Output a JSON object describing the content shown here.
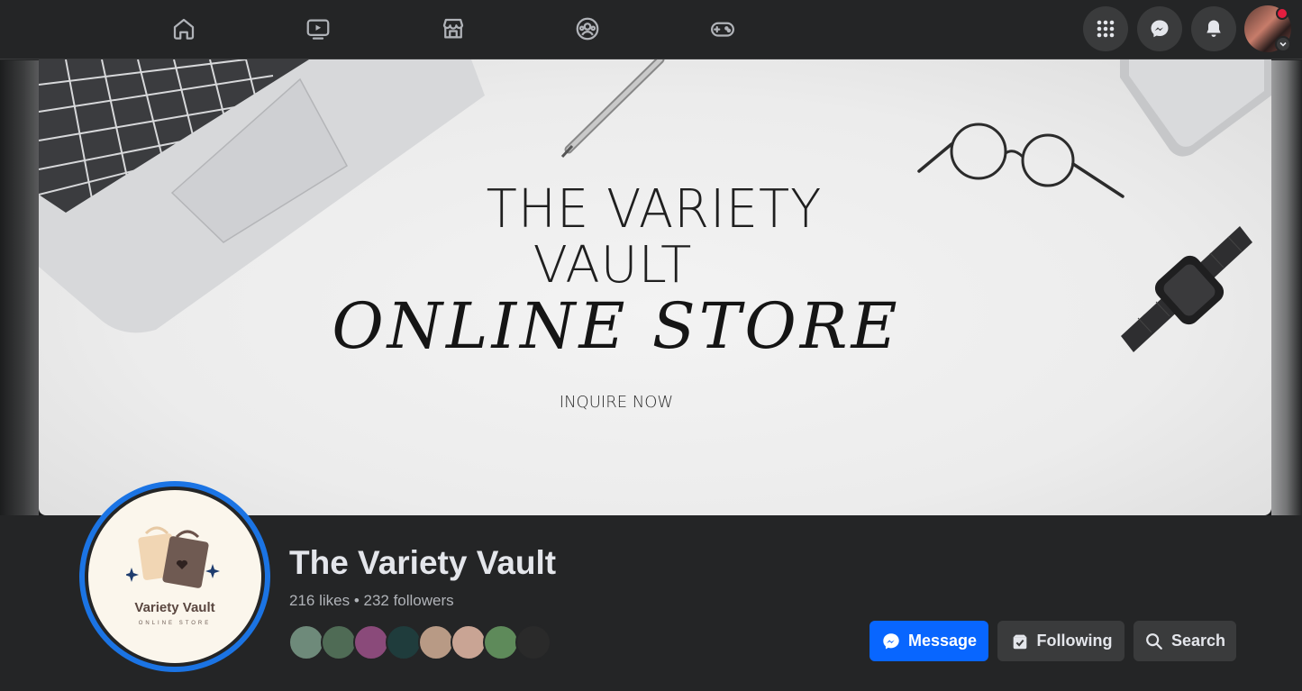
{
  "nav": {
    "tabs": [
      {
        "name": "home",
        "icon": "home-icon"
      },
      {
        "name": "watch",
        "icon": "video-icon"
      },
      {
        "name": "marketplace",
        "icon": "store-icon"
      },
      {
        "name": "groups",
        "icon": "groups-icon"
      },
      {
        "name": "gaming",
        "icon": "gaming-icon"
      }
    ],
    "right_buttons": [
      "menu-grid-icon",
      "messenger-icon",
      "bell-icon"
    ],
    "notification_color": "#e41e3f"
  },
  "cover": {
    "line1": "THE VARIETY",
    "line2": "VAULT",
    "line3": "ONLINE STORE",
    "line4": "INQUIRE NOW"
  },
  "profile": {
    "logo_name": "Variety Vault",
    "logo_sub": "ONLINE STORE",
    "ring_color": "#1b74e4"
  },
  "page": {
    "name": "The Variety Vault",
    "stats": "216 likes • 232 followers"
  },
  "friend_avatars": [
    {
      "color": "#6e8a7a"
    },
    {
      "color": "#4f6b55"
    },
    {
      "color": "#8a4a7a"
    },
    {
      "color": "#1f3c3c"
    },
    {
      "color": "#b89a85"
    },
    {
      "color": "#c9a494"
    },
    {
      "color": "#5e8a5a"
    },
    {
      "color": "#2a2a2a"
    }
  ],
  "actions": {
    "message": "Message",
    "following": "Following",
    "search": "Search"
  },
  "colors": {
    "primary": "#0866ff",
    "surface": "#242526",
    "button": "#3a3b3c"
  }
}
